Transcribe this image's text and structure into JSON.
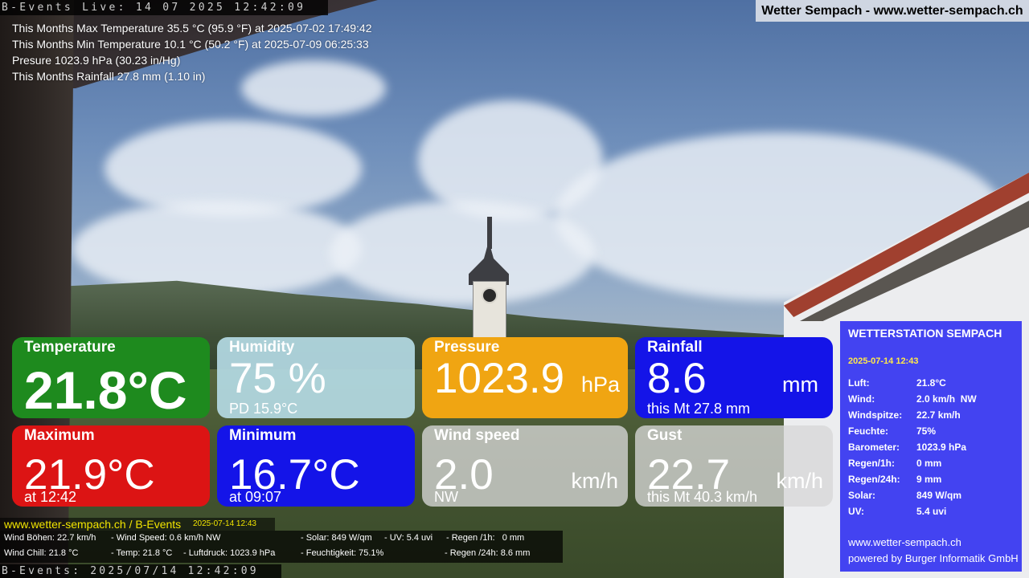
{
  "live_bar": "B-Events Live: 14 07 2025 12:42:09",
  "site_title": "Wetter Sempach - www.wetter-sempach.ch",
  "stats": {
    "max_temp": "This Months Max Temperature 35.5 °C (95.9 °F) at 2025-07-02 17:49:42",
    "min_temp": "This Months Min Temperature 10.1 °C (50.2 °F) at 2025-07-09 06:25:33",
    "pressure": "Presure 1023.9 hPa (30.23 in/Hg)",
    "rainfall": "This Months Rainfall 27.8 mm (1.10 in)"
  },
  "tiles": {
    "temperature": {
      "title": "Temperature",
      "value": "21.8°C",
      "color": "#1e8a1e"
    },
    "humidity": {
      "title": "Humidity",
      "value": "75 %",
      "sub": "PD 15.9°C",
      "color": "#b4dae4"
    },
    "pressure": {
      "title": "Pressure",
      "value": "1023.9",
      "unit": "hPa",
      "color": "#f0a512"
    },
    "rainfall": {
      "title": "Rainfall",
      "value": "8.6",
      "unit": "mm",
      "sub": "this Mt 27.8 mm",
      "color": "#1414e8"
    },
    "maximum": {
      "title": "Maximum",
      "value": "21.9°C",
      "sub": "at 12:42",
      "color": "#dc1414"
    },
    "minimum": {
      "title": "Minimum",
      "value": "16.7°C",
      "sub": "at 09:07",
      "color": "#1414e8"
    },
    "wind_speed": {
      "title": "Wind speed",
      "value": "2.0",
      "unit": "km/h",
      "sub": "NW",
      "color": "#d7d7d7"
    },
    "gust": {
      "title": "Gust",
      "value": "22.7",
      "unit": "km/h",
      "sub": "this Mt 40.3 km/h",
      "color": "#d7d7d7"
    }
  },
  "station": {
    "title": "WETTERSTATION SEMPACH",
    "date": "2025-07-14 12:43",
    "rows": [
      {
        "key": "Luft:",
        "value": "21.8°C"
      },
      {
        "key": "Wind:",
        "value": "2.0 km/h  NW"
      },
      {
        "key": "Windspitze:",
        "value": "22.7 km/h"
      },
      {
        "key": "Feuchte:",
        "value": "75%"
      },
      {
        "key": "Barometer:",
        "value": "1023.9 hPa"
      },
      {
        "key": "Regen/1h:",
        "value": "0 mm"
      },
      {
        "key": "Regen/24h:",
        "value": "9 mm"
      },
      {
        "key": "Solar:",
        "value": "849 W/qm"
      },
      {
        "key": "UV:",
        "value": "5.4 uvi"
      }
    ],
    "url": "www.wetter-sempach.ch",
    "powered": "powered by Burger Informatik GmbH"
  },
  "ticker": {
    "header_url": "www.wetter-sempach.ch / B-Events",
    "header_stamp": "2025-07-14 12:43",
    "line1": {
      "a": "Wind Böhen: 22.7 km/h",
      "b": "- Wind Speed: 0.6 km/h NW",
      "c": "- Solar: 849 W/qm",
      "d": "- UV: 5.4 uvi",
      "e": "- Regen /1h:   0 mm"
    },
    "line2": {
      "a": "Wind Chill: 21.8 °C",
      "b": "- Temp: 21.8 °C",
      "c": "- Luftdruck: 1023.9 hPa",
      "d": "- Feuchtigkeit: 75.1%",
      "e": "- Regen /24h: 8.6 mm"
    }
  },
  "bottom_bar": "B-Events: 2025/07/14 12:42:09"
}
